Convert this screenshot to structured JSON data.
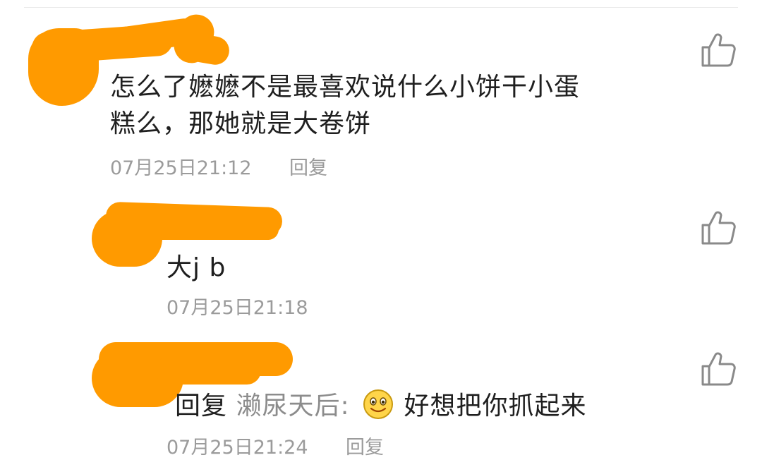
{
  "comments": [
    {
      "text_line1": "怎么了嬷嬷不是最喜欢说什么小饼干小蛋",
      "text_line2": "糕么，那她就是大卷饼",
      "timestamp": "07月25日21:12",
      "reply_label": "回复"
    },
    {
      "text": "大j b",
      "timestamp": "07月25日21:18"
    },
    {
      "reply_prefix": "回复",
      "reply_target": "濑尿天后:",
      "emoji": "smile-emoji",
      "text": "好想把你抓起来",
      "timestamp_partial": "07月25日21:24",
      "reply_label": "回复"
    }
  ],
  "icons": {
    "like": "thumbs-up-icon"
  },
  "colors": {
    "redaction": "#ff9a00",
    "meta_text": "#9b9b9b",
    "icon": "#8a8a8a"
  }
}
